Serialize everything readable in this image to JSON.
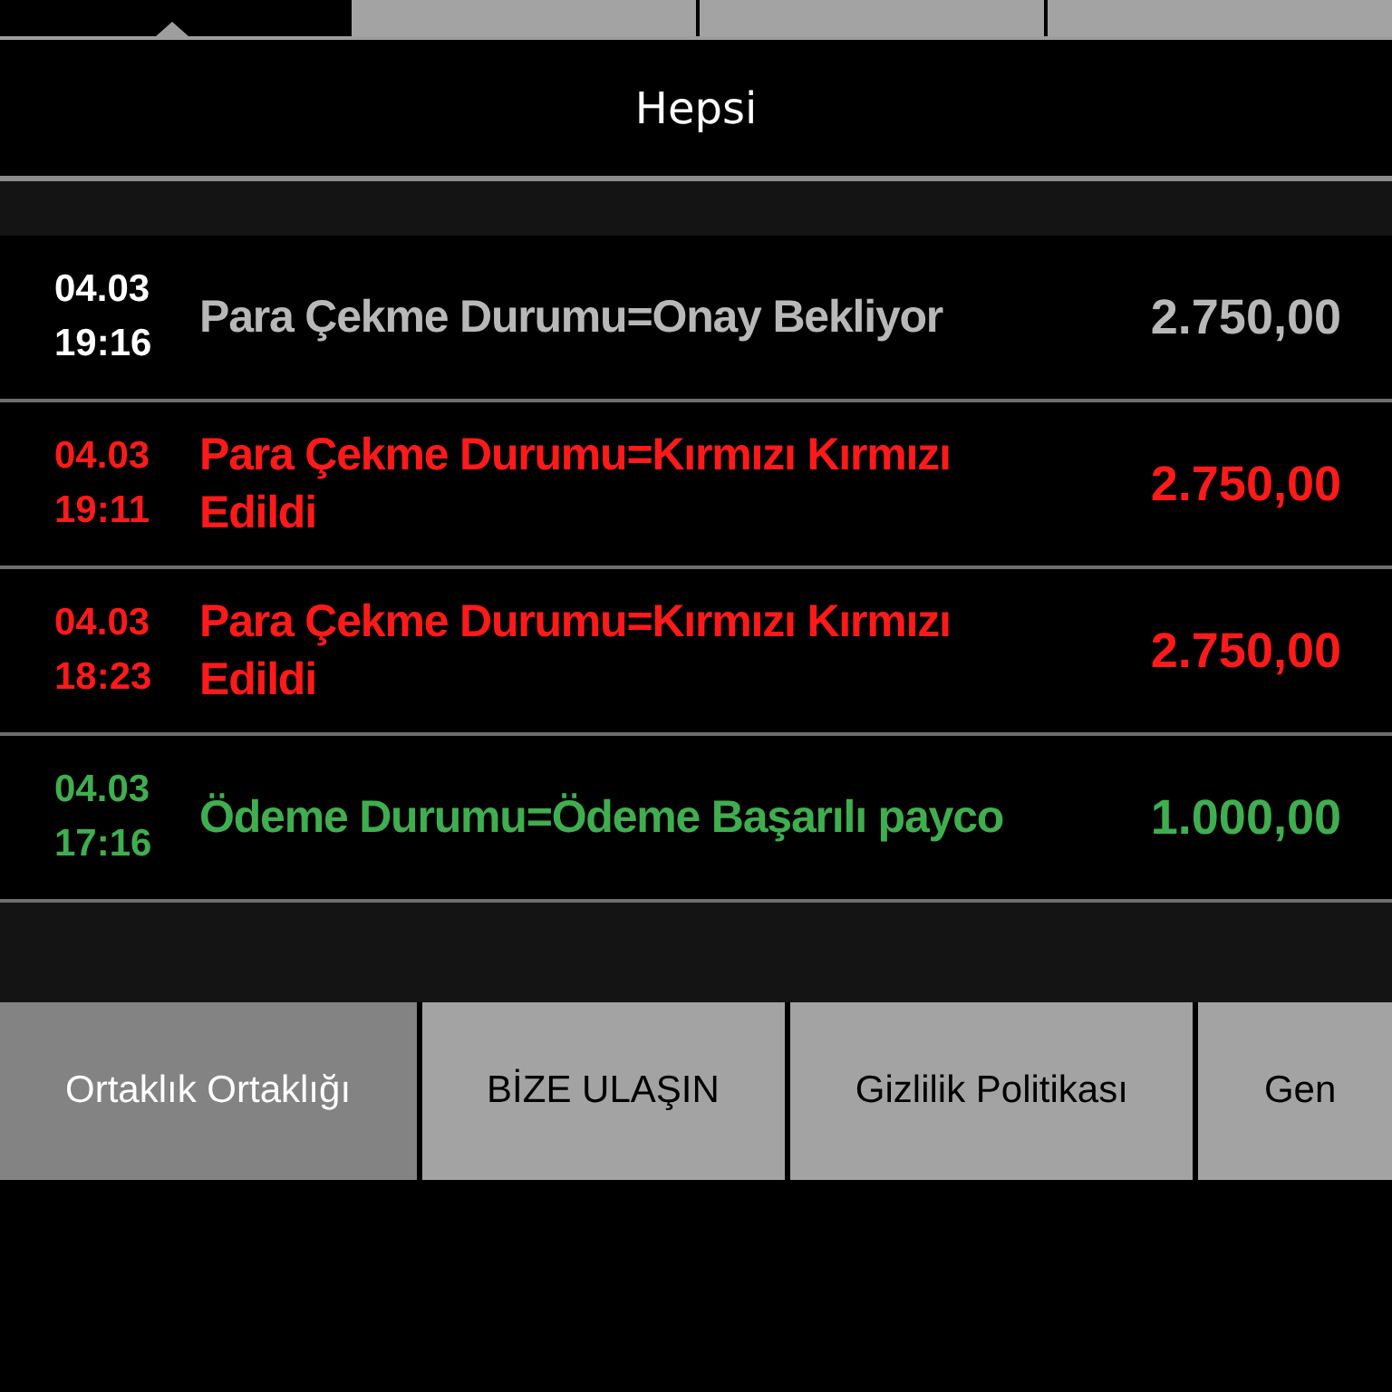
{
  "top_tabs": [
    {
      "selected": true
    },
    {
      "selected": false
    },
    {
      "selected": false
    },
    {
      "selected": false
    }
  ],
  "filter": {
    "label": "Hepsi"
  },
  "transactions": [
    {
      "kind": "pending",
      "date": "04.03",
      "time": "19:16",
      "description": "Para Çekme Durumu=Onay Bekliyor",
      "amount": "2.750,00"
    },
    {
      "kind": "rejected",
      "date": "04.03",
      "time": "19:11",
      "description": "Para Çekme Durumu=Kırmızı Kırmızı Edildi",
      "amount": "2.750,00"
    },
    {
      "kind": "rejected",
      "date": "04.03",
      "time": "18:23",
      "description": "Para Çekme Durumu=Kırmızı Kırmızı Edildi",
      "amount": "2.750,00"
    },
    {
      "kind": "success",
      "date": "04.03",
      "time": "17:16",
      "description": "Ödeme Durumu=Ödeme Başarılı payco",
      "amount": "1.000,00"
    }
  ],
  "footer_tabs": [
    {
      "label": "Ortaklık Ortaklığı",
      "selected": true
    },
    {
      "label": "BİZE ULAŞIN",
      "selected": false
    },
    {
      "label": "Gizlilik Politikası",
      "selected": false
    },
    {
      "label": "Gen",
      "selected": false
    }
  ]
}
